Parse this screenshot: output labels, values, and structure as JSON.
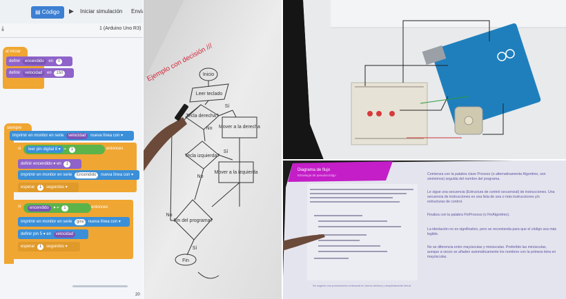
{
  "tinkercad": {
    "code_label": "Código",
    "simulate_label": "Iniciar simulación",
    "send_label": "Envia",
    "board_label": "1 (Arduino Uno R3)",
    "setup_hat": "al iniciar",
    "set_on": {
      "prefix": "definir",
      "var": "encendido",
      "mid": "en",
      "value": "0"
    },
    "set_speed": {
      "prefix": "definir",
      "var": "velocidad",
      "mid": "en",
      "value": "150"
    },
    "loop_hat": "siempre",
    "print1": {
      "prefix": "imprimir en monitor en serie",
      "var": "velocidad",
      "mid": "nueva línea",
      "opt": "con"
    },
    "if1": {
      "prefix": "si",
      "read": "leer pin digital",
      "pin": "8",
      "op": "=",
      "value": "1",
      "suffix": "entonces"
    },
    "set_on2": {
      "prefix": "definir",
      "var": "encendido",
      "mid": "en",
      "value": "1"
    },
    "print2": {
      "prefix": "imprimir en monitor en serie",
      "var": "Encendido",
      "mid": "nueva línea",
      "opt": "con"
    },
    "wait1": {
      "prefix": "esperar",
      "value": "1",
      "unit": "segundos"
    },
    "if2": {
      "prefix": "si",
      "var": "encendido",
      "op": "=",
      "value": "1",
      "suffix": "entonces"
    },
    "print3": {
      "prefix": "imprimir en monitor en serie",
      "var": "gira",
      "mid": "nueva línea",
      "opt": "con"
    },
    "set_pin": {
      "prefix": "definir pin",
      "pin": "5",
      "mid": "en",
      "var": "velocidad"
    },
    "wait2": {
      "prefix": "esperar",
      "value": "1",
      "unit": "segundos"
    },
    "page_num": "20"
  },
  "flowchart": {
    "title": "Ejemplo con decisión ///",
    "start": "Inicio",
    "read": "Leer teclado",
    "decision1": "Tecla derecha?",
    "yes1": "Sí",
    "no1": "No",
    "right": "Mover a la derecha",
    "decision2": "Tecla izquierda?",
    "yes2": "Sí",
    "no2": "No",
    "left": "Mover a la izquierda",
    "decision3": "Fin del programa?",
    "no3": "No",
    "yes3": "Sí",
    "end": "Fin"
  },
  "slide": {
    "title": "Diagrama de flujo",
    "subtitle": "Estrategia de pseudocódigo",
    "notes": [
      "Comienza con la palabra clave Proceso (o alternativamente Algoritmo, son sinónimos) seguida del nombre del programa.",
      "Le sigue una secuencia (Estructura de control secuencial) de instrucciones. Una secuencia de instrucciones es una lista de una o más instrucciones y/o estructuras de control.",
      "Finaliza con la palabra FinProceso (o FinAlgoritmo).",
      "La identación no es significativo, pero se recomienda para que el código sea más legible.",
      "No se diferencia entre mayúsculas y minúsculas. Preferible las minúsculas, aunque a veces se añaden automáticamente los nombres con la primera letra en mayúsculas."
    ],
    "footer": "Se sugiere una presentación ordenada en forma vertical y completamente literal."
  },
  "colors": {
    "orange": "#f0a632",
    "purple": "#8f63c9",
    "blue": "#3a8fd8",
    "green": "#5cb34a",
    "accent_red": "#d0283a",
    "slide_pink": "#c31ec7"
  }
}
